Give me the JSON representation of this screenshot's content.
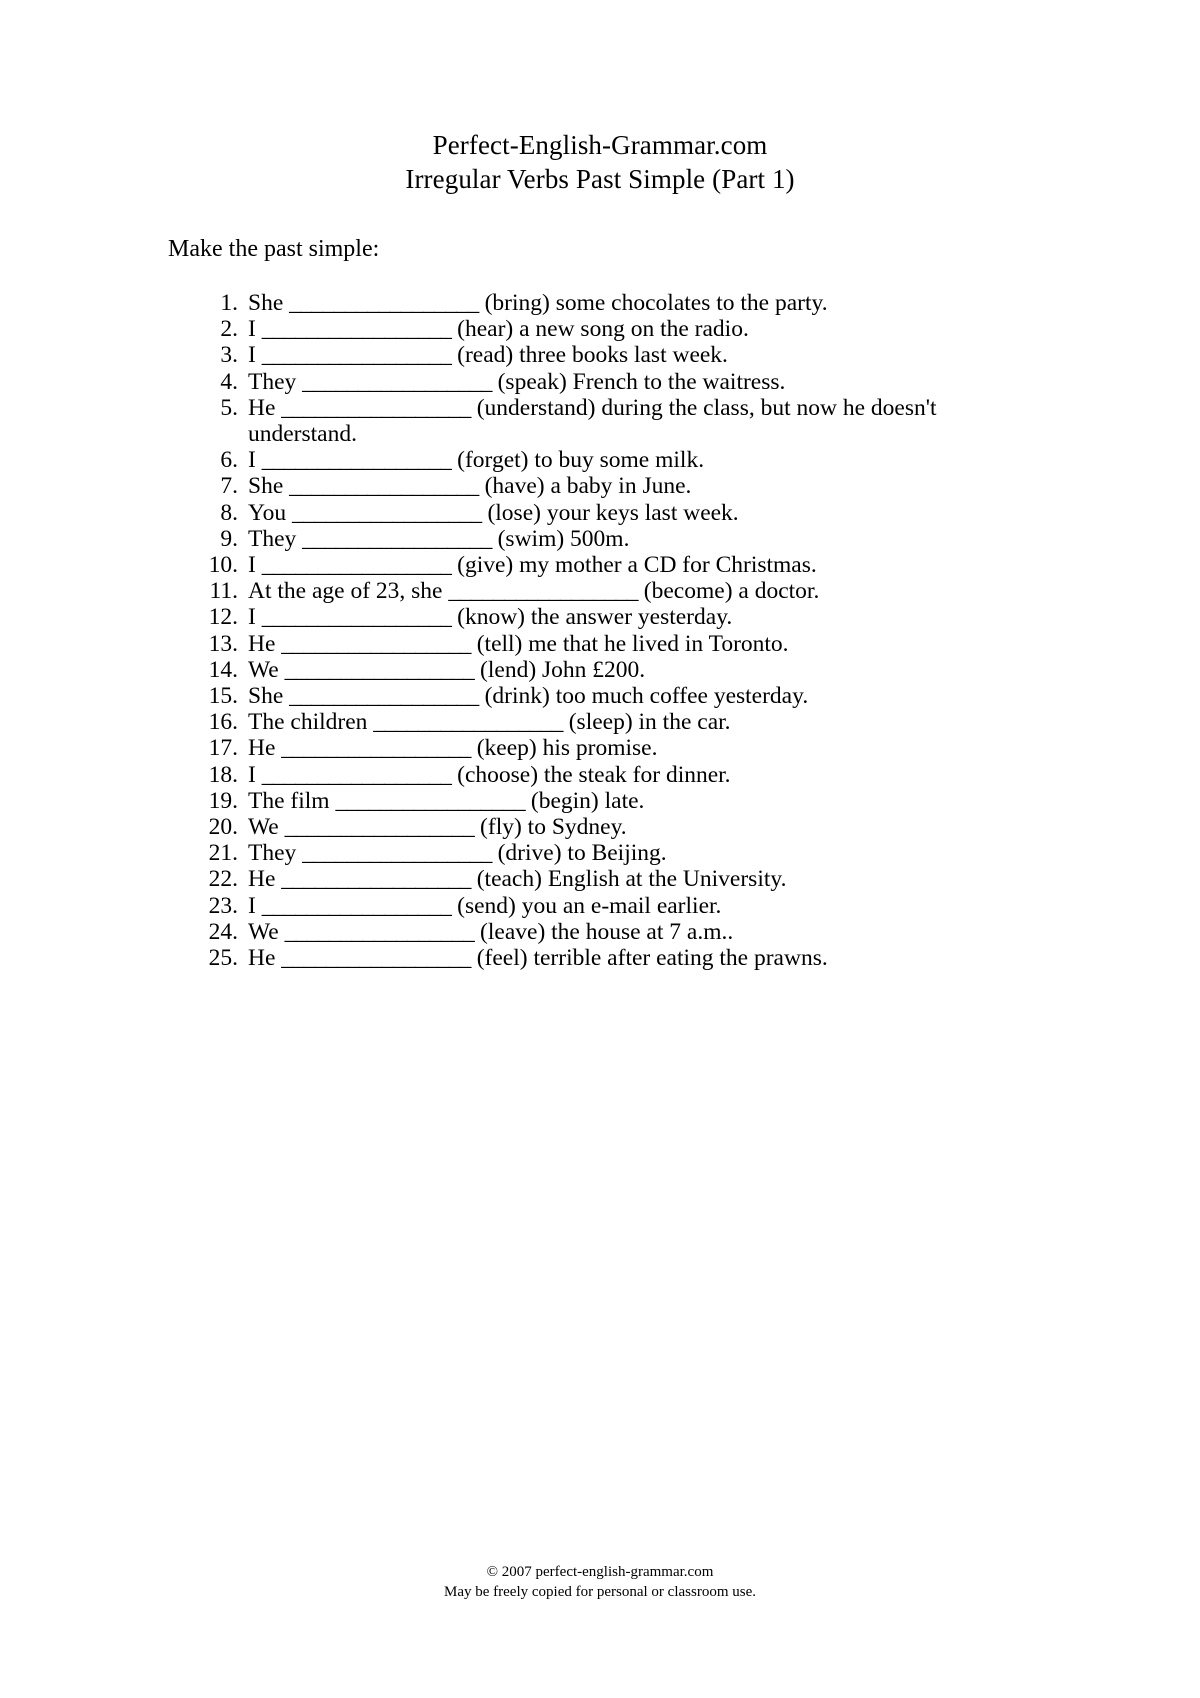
{
  "header": {
    "site_title": "Perfect-English-Grammar.com",
    "worksheet_title": "Irregular Verbs Past Simple (Part 1)"
  },
  "instruction": "Make the past simple:",
  "blank": "_________________",
  "exercise": {
    "items": [
      {
        "number": "1.",
        "before": "She ",
        "blank": "_________________",
        "after": " (bring) some chocolates to the party."
      },
      {
        "number": "2.",
        "before": "I ",
        "blank": "_________________",
        "after": " (hear) a new song on the radio."
      },
      {
        "number": "3.",
        "before": "I ",
        "blank": "_________________",
        "after": " (read) three books last week."
      },
      {
        "number": "4.",
        "before": "They ",
        "blank": "_________________",
        "after": " (speak) French to the waitress."
      },
      {
        "number": "5.",
        "before": "He ",
        "blank": "_________________",
        "after": " (understand) during the class, but now he doesn't understand."
      },
      {
        "number": "6.",
        "before": "I ",
        "blank": "_________________",
        "after": " (forget) to buy some milk."
      },
      {
        "number": "7.",
        "before": "She ",
        "blank": "_________________",
        "after": " (have) a baby in June."
      },
      {
        "number": "8.",
        "before": "You ",
        "blank": "_________________",
        "after": " (lose) your keys last week."
      },
      {
        "number": "9.",
        "before": "They ",
        "blank": "_________________",
        "after": " (swim) 500m."
      },
      {
        "number": "10.",
        "before": "I ",
        "blank": "_________________",
        "after": " (give) my mother a CD for Christmas."
      },
      {
        "number": "11.",
        "before": "At the age of 23, she ",
        "blank": "_________________",
        "after": " (become) a doctor."
      },
      {
        "number": "12.",
        "before": "I ",
        "blank": "_________________",
        "after": " (know) the answer yesterday."
      },
      {
        "number": "13.",
        "before": "He ",
        "blank": "_________________",
        "after": " (tell) me that he lived in Toronto."
      },
      {
        "number": "14.",
        "before": "We ",
        "blank": "_________________",
        "after": " (lend) John £200."
      },
      {
        "number": "15.",
        "before": "She ",
        "blank": "_________________",
        "after": " (drink) too much coffee yesterday."
      },
      {
        "number": "16.",
        "before": "The children ",
        "blank": "_________________",
        "after": " (sleep) in the car."
      },
      {
        "number": "17.",
        "before": "He ",
        "blank": "_________________",
        "after": " (keep) his promise."
      },
      {
        "number": "18.",
        "before": "I ",
        "blank": "_________________",
        "after": " (choose) the steak for dinner."
      },
      {
        "number": "19.",
        "before": "The film ",
        "blank": "_________________",
        "after": " (begin) late."
      },
      {
        "number": "20.",
        "before": "We ",
        "blank": "_________________",
        "after": " (fly) to Sydney."
      },
      {
        "number": "21.",
        "before": "They ",
        "blank": "_________________",
        "after": " (drive) to Beijing."
      },
      {
        "number": "22.",
        "before": "He ",
        "blank": "_________________",
        "after": " (teach) English at the University."
      },
      {
        "number": "23.",
        "before": "I ",
        "blank": "_________________",
        "after": " (send) you an e-mail earlier."
      },
      {
        "number": "24.",
        "before": "We ",
        "blank": "_________________",
        "after": " (leave) the house at 7 a.m.."
      },
      {
        "number": "25.",
        "before": "He ",
        "blank": "_________________",
        "after": " (feel) terrible after eating the prawns."
      }
    ]
  },
  "footer": {
    "copyright": "© 2007 perfect-english-grammar.com",
    "usage": "May be freely copied for personal or classroom use."
  }
}
